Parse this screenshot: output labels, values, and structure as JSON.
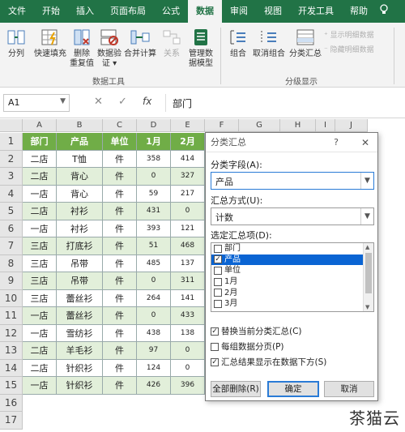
{
  "ribbon": {
    "tabs": [
      "文件",
      "开始",
      "插入",
      "页面布局",
      "公式",
      "数据",
      "审阅",
      "视图",
      "开发工具",
      "帮助"
    ],
    "active_tab": "数据",
    "tools": {
      "split": "分列",
      "flash_fill": "快速填充",
      "remove_dup_1": "删除",
      "remove_dup_2": "重复值",
      "validation_1": "数据验",
      "validation_2": "证 ▾",
      "consolidate": "合并计算",
      "relations": "关系",
      "manage_1": "管理数",
      "manage_2": "据模型",
      "group_label": "数据工具"
    },
    "outline": {
      "group": "组合",
      "ungroup": "取消组合",
      "subtotal": "分类汇总",
      "show_detail": "显示明细数据",
      "hide_detail": "隐藏明细数据",
      "group_label": "分级显示"
    }
  },
  "formula_bar": {
    "name_box": "A1",
    "fx": "fx",
    "content": "部门"
  },
  "sheet": {
    "columns": [
      "A",
      "B",
      "C",
      "D",
      "E",
      "F",
      "G",
      "H",
      "I",
      "J"
    ],
    "rows": [
      "1",
      "2",
      "3",
      "4",
      "5",
      "6",
      "7",
      "8",
      "9",
      "10",
      "11",
      "12",
      "13",
      "14",
      "15",
      "16",
      "17"
    ],
    "header": [
      "部门",
      "产品",
      "单位",
      "1月",
      "2月"
    ],
    "data": [
      [
        "二店",
        "T恤",
        "件",
        "358",
        "414"
      ],
      [
        "二店",
        "背心",
        "件",
        "0",
        "327"
      ],
      [
        "一店",
        "背心",
        "件",
        "59",
        "217"
      ],
      [
        "二店",
        "衬衫",
        "件",
        "431",
        "0"
      ],
      [
        "一店",
        "衬衫",
        "件",
        "393",
        "121"
      ],
      [
        "三店",
        "打底衫",
        "件",
        "51",
        "468"
      ],
      [
        "三店",
        "吊带",
        "件",
        "485",
        "137"
      ],
      [
        "三店",
        "吊带",
        "件",
        "0",
        "311"
      ],
      [
        "三店",
        "蕾丝衫",
        "件",
        "264",
        "141"
      ],
      [
        "一店",
        "蕾丝衫",
        "件",
        "0",
        "433"
      ],
      [
        "一店",
        "雪纺衫",
        "件",
        "438",
        "138"
      ],
      [
        "二店",
        "羊毛衫",
        "件",
        "97",
        "0"
      ],
      [
        "二店",
        "针织衫",
        "件",
        "124",
        "0"
      ],
      [
        "一店",
        "针织衫",
        "件",
        "426",
        "396"
      ]
    ]
  },
  "dialog": {
    "title": "分类汇总",
    "help": "?",
    "close": "✕",
    "group_by_label": "分类字段(A):",
    "group_by_value": "产品",
    "function_label": "汇总方式(U):",
    "function_value": "计数",
    "items_label": "选定汇总项(D):",
    "items": [
      {
        "label": "部门",
        "checked": false,
        "selected": false
      },
      {
        "label": "产品",
        "checked": true,
        "selected": true
      },
      {
        "label": "单位",
        "checked": false,
        "selected": false
      },
      {
        "label": "1月",
        "checked": false,
        "selected": false
      },
      {
        "label": "2月",
        "checked": false,
        "selected": false
      },
      {
        "label": "3月",
        "checked": false,
        "selected": false
      }
    ],
    "replace_current": "替换当前分类汇总(C)",
    "page_break": "每组数据分页(P)",
    "summary_below": "汇总结果显示在数据下方(S)",
    "remove_all": "全部删除(R)",
    "ok": "确定",
    "cancel": "取消"
  },
  "watermark": "茶猫云",
  "colors": {
    "ribbon_green": "#217346",
    "header_fill": "#70ad47",
    "alt_row_fill": "#e2efda",
    "selection_blue": "#0a64d3"
  }
}
